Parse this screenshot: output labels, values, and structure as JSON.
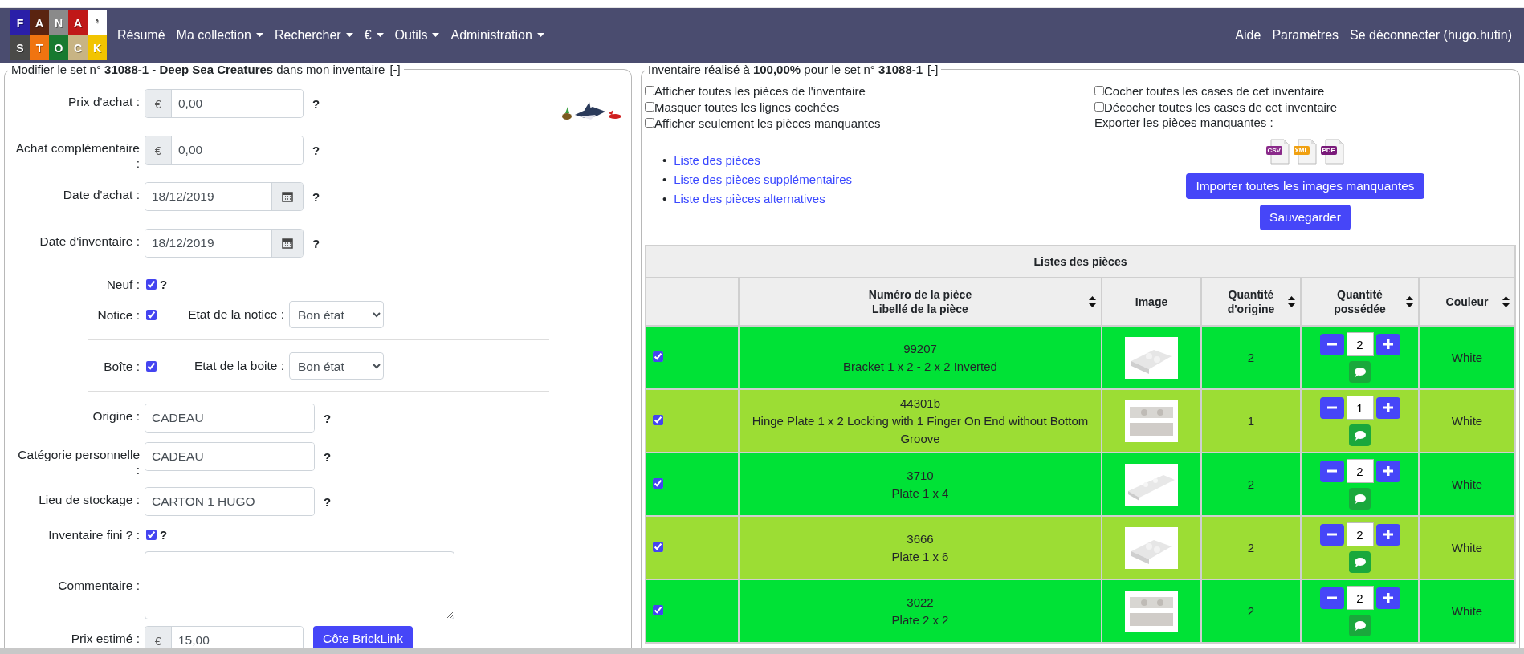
{
  "nav": {
    "logo": [
      {
        "letter": "F",
        "color": "#2a1fa8"
      },
      {
        "letter": "A",
        "color": "#5a2410"
      },
      {
        "letter": "N",
        "color": "#8a8a8a"
      },
      {
        "letter": "A",
        "color": "#c01818"
      },
      {
        "letter": "’",
        "color": "#ffffff"
      },
      {
        "letter": "S",
        "color": "#4a4a48"
      },
      {
        "letter": "T",
        "color": "#f07410"
      },
      {
        "letter": "O",
        "color": "#187a30"
      },
      {
        "letter": "C",
        "color": "#c8b484"
      },
      {
        "letter": "K",
        "color": "#f2c400"
      }
    ],
    "menu": [
      {
        "label": "Résumé",
        "dropdown": false
      },
      {
        "label": "Ma collection",
        "dropdown": true
      },
      {
        "label": "Rechercher",
        "dropdown": true
      },
      {
        "label": "€",
        "dropdown": true
      },
      {
        "label": "Outils",
        "dropdown": true
      },
      {
        "label": "Administration",
        "dropdown": true
      }
    ],
    "right": [
      "Aide",
      "Paramètres",
      "Se déconnecter (hugo.hutin)"
    ]
  },
  "form_panel": {
    "legend": "Modifier le set n° **31088-1** - **Deep Sea Creatures** dans mon inventaire",
    "toggle": "[-]",
    "fields": [
      {
        "kind": "money",
        "label": "Prix d'achat :",
        "addon": "€",
        "value": "0,00",
        "help": "?"
      },
      {
        "kind": "money",
        "label": "Achat complémentaire :",
        "addon": "€",
        "value": "0,00",
        "help": "?"
      },
      {
        "kind": "date",
        "label": "Date d'achat :",
        "value": "18/12/2019",
        "help": "?"
      },
      {
        "kind": "date",
        "label": "Date d'inventaire :",
        "value": "18/12/2019",
        "help": "?"
      },
      {
        "kind": "check",
        "label": "Neuf :",
        "checked": true,
        "help": "?"
      },
      {
        "kind": "check_select",
        "label": "Notice :",
        "checked": true,
        "select_label": "Etat de la notice :",
        "select_value": "Bon état"
      },
      {
        "kind": "divider"
      },
      {
        "kind": "check_select",
        "label": "Boîte :",
        "checked": true,
        "select_label": "Etat de la boite :",
        "select_value": "Bon état"
      },
      {
        "kind": "divider"
      },
      {
        "kind": "text",
        "label": "Origine :",
        "value": "CADEAU",
        "help": "?"
      },
      {
        "kind": "text",
        "label": "Catégorie personnelle :",
        "value": "CADEAU",
        "help": "?"
      },
      {
        "kind": "text",
        "label": "Lieu de stockage :",
        "value": "CARTON 1 HUGO",
        "help": "?"
      },
      {
        "kind": "check",
        "label": "Inventaire fini ? :",
        "checked": true,
        "help": "?"
      },
      {
        "kind": "textarea",
        "label": "Commentaire :"
      },
      {
        "kind": "money_button",
        "label": "Prix estimé :",
        "addon": "€",
        "value": "15,00",
        "button": "Côte BrickLink"
      }
    ]
  },
  "inventory_panel": {
    "legend": "Inventaire réalisé à **100,00%** pour le set n° **31088-1**",
    "toggle": "[-]",
    "left_options": [
      {
        "label": "Afficher toutes les pièces de l'inventaire",
        "checked": false
      },
      {
        "label": "Masquer toutes les lignes cochées",
        "checked": false
      },
      {
        "label": "Afficher seulement les pièces manquantes",
        "checked": false
      }
    ],
    "right_options": [
      {
        "label": "Cocher toutes les cases de cet inventaire",
        "checked": false
      },
      {
        "label": "Décocher toutes les cases de cet inventaire",
        "checked": false
      }
    ],
    "export_label": "Exporter les pièces manquantes :",
    "export_formats": [
      {
        "label": "CSV",
        "color": "#8a2a8a"
      },
      {
        "label": "XML",
        "color": "#f0a010"
      },
      {
        "label": "PDF",
        "color": "#7a1a7a"
      }
    ],
    "links": [
      {
        "bullet": "•",
        "label": "Liste des pièces"
      },
      {
        "bullet": "•",
        "label": "Liste des pièces supplémentaires"
      },
      {
        "bullet": "•",
        "label": "Liste des pièces alternatives"
      }
    ],
    "buttons": [
      "Importer toutes les images manquantes",
      "Sauvegarder"
    ],
    "table": {
      "title": "Listes des pièces",
      "columns": [
        {
          "lines": [
            "Numéro de la pièce",
            "Libellé de la pièce"
          ],
          "sortable": true
        },
        {
          "lines": [
            "Image"
          ],
          "sortable": false
        },
        {
          "lines": [
            "Quantité",
            "d'origine"
          ],
          "sortable": true
        },
        {
          "lines": [
            "Quantité",
            "possédée"
          ],
          "sortable": true
        },
        {
          "lines": [
            "Couleur"
          ],
          "sortable": true
        }
      ],
      "rows": [
        {
          "checked": true,
          "color": "#00e236",
          "number": "99207",
          "name": "Bracket 1 x 2 - 2 x 2 Inverted",
          "qty_origin": "2",
          "qty_owned": "2",
          "color_name": "White"
        },
        {
          "checked": true,
          "color": "#9cdd34",
          "number": "44301b",
          "name": "Hinge Plate 1 x 2 Locking with 1 Finger On End without Bottom Groove",
          "qty_origin": "1",
          "qty_owned": "1",
          "color_name": "White"
        },
        {
          "checked": true,
          "color": "#00e236",
          "number": "3710",
          "name": "Plate 1 x 4",
          "qty_origin": "2",
          "qty_owned": "2",
          "color_name": "White"
        },
        {
          "checked": true,
          "color": "#9cdd34",
          "number": "3666",
          "name": "Plate 1 x 6",
          "qty_origin": "2",
          "qty_owned": "2",
          "color_name": "White"
        },
        {
          "checked": true,
          "color": "#00e236",
          "number": "3022",
          "name": "Plate 2 x 2",
          "qty_origin": "2",
          "qty_owned": "2",
          "color_name": "White"
        }
      ]
    }
  }
}
